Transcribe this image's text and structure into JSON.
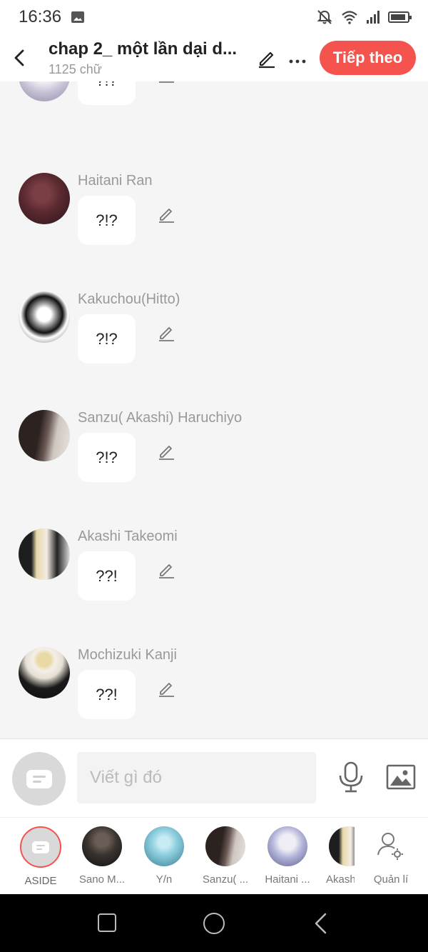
{
  "status_bar": {
    "time": "16:36"
  },
  "header": {
    "title": "chap 2_ một lần dại d...",
    "word_count": "1125 chữ",
    "next_button": "Tiếp theo"
  },
  "messages": [
    {
      "sender": "",
      "text": "?!?",
      "avatar_colors": [
        "#c9c3d6",
        "#ffffff"
      ]
    },
    {
      "sender": "Haitani Ran",
      "text": "?!?",
      "avatar_colors": [
        "#5a2a30",
        "#2a1418"
      ]
    },
    {
      "sender": "Kakuchou(Hitto)",
      "text": "?!?",
      "avatar_colors": [
        "#ffffff",
        "#111111"
      ]
    },
    {
      "sender": "Sanzu( Akashi) Haruchiyo",
      "text": "?!?",
      "avatar_colors": [
        "#3a2a28",
        "#cfc6c0"
      ]
    },
    {
      "sender": "Akashi Takeomi",
      "text": "??!",
      "avatar_colors": [
        "#222222",
        "#e8d9a8"
      ]
    },
    {
      "sender": "Mochizuki Kanji",
      "text": "??!",
      "avatar_colors": [
        "#1a1a1a",
        "#e6e0d4"
      ]
    }
  ],
  "input_bar": {
    "placeholder": "Viết gì đó"
  },
  "characters": [
    {
      "label": "ASIDE",
      "type": "aside"
    },
    {
      "label": "Sano M...",
      "avatar_colors": [
        "#3a3430",
        "#111111"
      ]
    },
    {
      "label": "Y/n",
      "avatar_colors": [
        "#8fd0e0",
        "#3a7c93"
      ]
    },
    {
      "label": "Sanzu( ...",
      "avatar_colors": [
        "#3a2a28",
        "#cfc6c0"
      ]
    },
    {
      "label": "Haitani ...",
      "avatar_colors": [
        "#b0b2d8",
        "#f0eef5"
      ]
    },
    {
      "label": "Akash",
      "avatar_colors": [
        "#222222",
        "#e8d9a8"
      ]
    },
    {
      "label": "Quản lí",
      "type": "manage"
    }
  ],
  "colors": {
    "accent": "#f4534e",
    "background": "#f5f5f5",
    "sender_text": "#999999"
  }
}
